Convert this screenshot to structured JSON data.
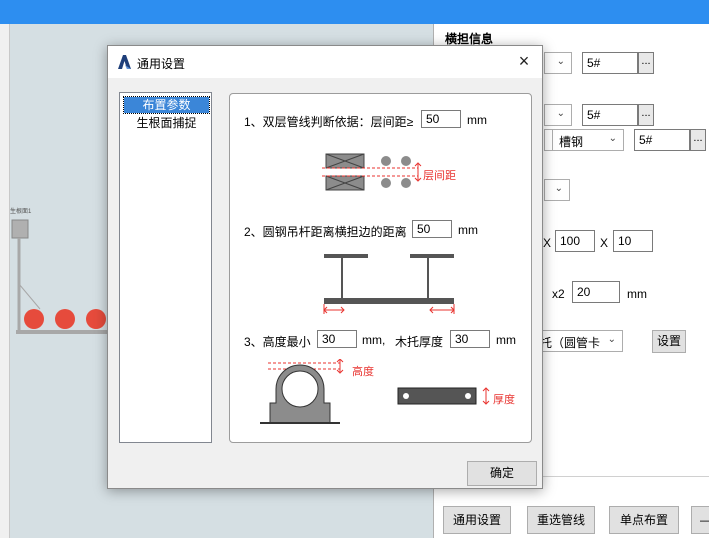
{
  "panel": {
    "section_title": "横担信息",
    "row1_value": "5#",
    "row2_value": "5#",
    "row3_combo": "槽钢",
    "row3_value": "5#",
    "x_label": "X",
    "dim_a": "100",
    "dim_b": "10",
    "x2_label": "x2",
    "x2_value": "20",
    "unit_mm": "mm",
    "support_combo": "托（圆管卡",
    "settings_button": "设置",
    "ellipsis": "...",
    "bottom_buttons": [
      "通用设置",
      "重选管线",
      "单点布置",
      "—"
    ]
  },
  "canvas": {
    "label": "生根面1"
  },
  "dialog": {
    "title": "通用设置",
    "close": "×",
    "nav": [
      "布置参数",
      "生根面捕捉"
    ],
    "q1_label": "1、双层管线判断依据：层间距≥",
    "q1_value": "50",
    "q1_unit": "mm",
    "q1_fig_label": "层间距",
    "q2_label": "2、圆钢吊杆距离横担边的距离",
    "q2_value": "50",
    "q2_unit": "mm",
    "q3_label_a": "3、高度最小",
    "q3_value_a": "30",
    "q3_unit_a": "mm,",
    "q3_label_b": "木托厚度",
    "q3_value_b": "30",
    "q3_unit_b": "mm",
    "fig_height_label": "高度",
    "fig_thickness_label": "厚度",
    "ok_button": "确定"
  },
  "colors": {
    "accent": "#2d8ef0",
    "selection": "#3b86d8",
    "annotation_red": "#e8332f",
    "pipe_red": "#e64b3c"
  }
}
